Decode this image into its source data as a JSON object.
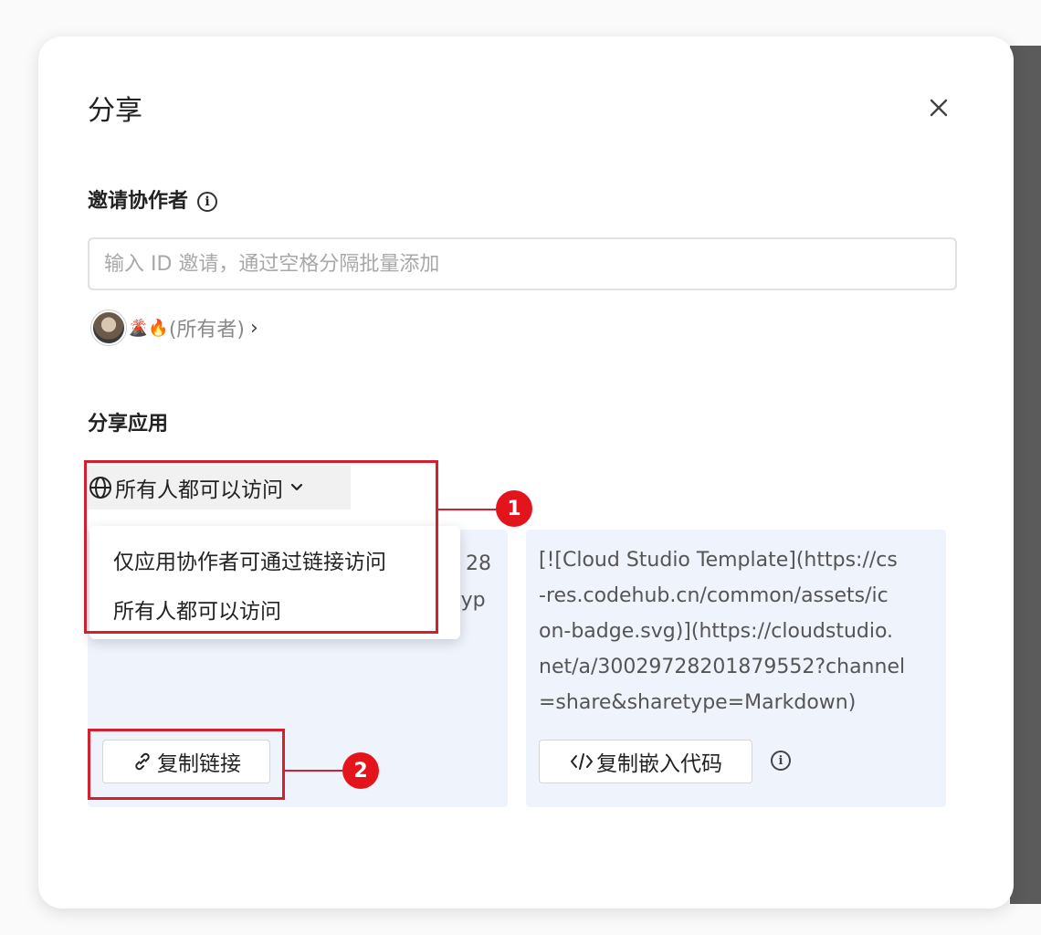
{
  "dialog": {
    "title": "分享",
    "close_icon": "close-icon"
  },
  "invite": {
    "label": "邀请协作者",
    "info_icon": "info-icon",
    "placeholder": "输入 ID 邀请，通过空格分隔批量添加",
    "value": "",
    "owner_emoji": "🌋🔥",
    "owner_role": "(所有者)",
    "owner_chevron": "›"
  },
  "share_app": {
    "label": "分享应用",
    "visibility": {
      "selected": "所有人都可以访问",
      "icon": "globe-icon",
      "chevron": "chevron-down-icon",
      "options": [
        "仅应用协作者可通过链接访问",
        "所有人都可以访问"
      ]
    },
    "link_panel": {
      "partial_text_lines": [
        "28",
        "typ"
      ],
      "copy_button": "复制链接",
      "copy_icon": "link-icon"
    },
    "embed_panel": {
      "code": "[![Cloud Studio Template](https://cs-res.codehub.cn/common/assets/icon-badge.svg)](https://cloudstudio.net/a/30029728201879552?channel=share&sharetype=Markdown)",
      "code_lines": [
        "[![Cloud Studio Template](https://cs",
        "-res.codehub.cn/common/assets/ic",
        "on-badge.svg)](https://cloudstudio.",
        "net/a/30029728201879552?channel",
        "=share&sharetype=Markdown)"
      ],
      "copy_button": "复制嵌入代码",
      "code_icon": "code-icon",
      "info_icon": "info-icon"
    }
  },
  "annotations": [
    {
      "label": "1"
    },
    {
      "label": "2"
    }
  ],
  "colors": {
    "accent": "#d2202f",
    "panel_bg": "#eff3fb"
  }
}
